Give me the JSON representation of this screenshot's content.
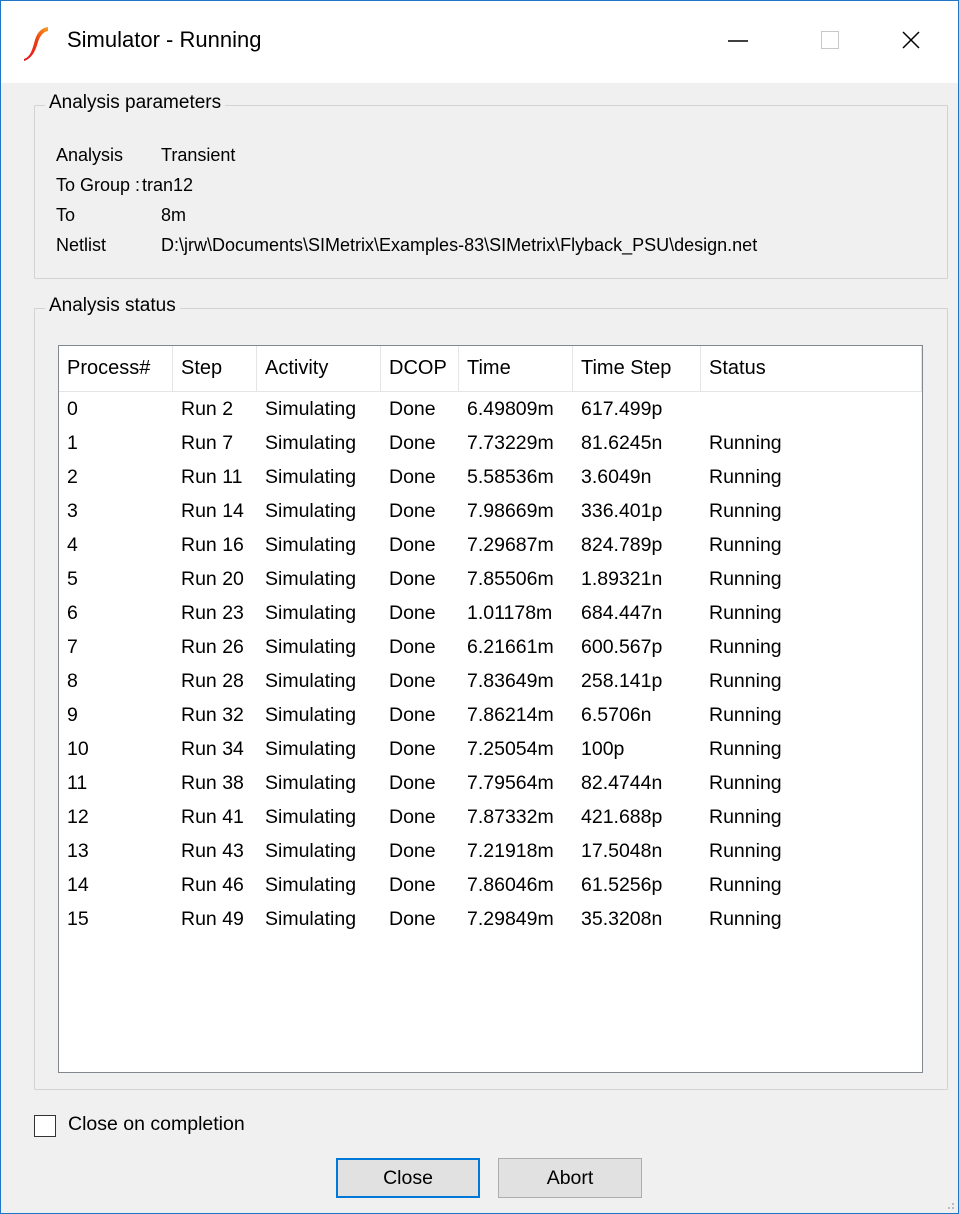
{
  "window": {
    "title": "Simulator - Running",
    "minimize_symbol": "—",
    "close_symbol": "✕"
  },
  "params": {
    "legend": "Analysis parameters",
    "rows": [
      {
        "label": "Analysis",
        "value": "Transient"
      },
      {
        "label": "To Group :",
        "value": "tran12"
      },
      {
        "label": "To",
        "value": "8m"
      },
      {
        "label": "Netlist",
        "value": "D:\\jrw\\Documents\\SIMetrix\\Examples-83\\SIMetrix\\Flyback_PSU\\design.net"
      }
    ]
  },
  "status": {
    "legend": "Analysis status",
    "columns": [
      "Process#",
      "Step",
      "Activity",
      "DCOP",
      "Time",
      "Time Step",
      "Status"
    ],
    "rows": [
      [
        "0",
        "Run 2",
        "Simulating",
        "Done",
        "6.49809m",
        "617.499p",
        ""
      ],
      [
        "1",
        "Run 7",
        "Simulating",
        "Done",
        "7.73229m",
        "81.6245n",
        "Running"
      ],
      [
        "2",
        "Run 11",
        "Simulating",
        "Done",
        "5.58536m",
        "3.6049n",
        "Running"
      ],
      [
        "3",
        "Run 14",
        "Simulating",
        "Done",
        "7.98669m",
        "336.401p",
        "Running"
      ],
      [
        "4",
        "Run 16",
        "Simulating",
        "Done",
        "7.29687m",
        "824.789p",
        "Running"
      ],
      [
        "5",
        "Run 20",
        "Simulating",
        "Done",
        "7.85506m",
        "1.89321n",
        "Running"
      ],
      [
        "6",
        "Run 23",
        "Simulating",
        "Done",
        "1.01178m",
        "684.447n",
        "Running"
      ],
      [
        "7",
        "Run 26",
        "Simulating",
        "Done",
        "6.21661m",
        "600.567p",
        "Running"
      ],
      [
        "8",
        "Run 28",
        "Simulating",
        "Done",
        "7.83649m",
        "258.141p",
        "Running"
      ],
      [
        "9",
        "Run 32",
        "Simulating",
        "Done",
        "7.86214m",
        "6.5706n",
        "Running"
      ],
      [
        "10",
        "Run 34",
        "Simulating",
        "Done",
        "7.25054m",
        "100p",
        "Running"
      ],
      [
        "11",
        "Run 38",
        "Simulating",
        "Done",
        "7.79564m",
        "82.4744n",
        "Running"
      ],
      [
        "12",
        "Run 41",
        "Simulating",
        "Done",
        "7.87332m",
        "421.688p",
        "Running"
      ],
      [
        "13",
        "Run 43",
        "Simulating",
        "Done",
        "7.21918m",
        "17.5048n",
        "Running"
      ],
      [
        "14",
        "Run 46",
        "Simulating",
        "Done",
        "7.86046m",
        "61.5256p",
        "Running"
      ],
      [
        "15",
        "Run 49",
        "Simulating",
        "Done",
        "7.29849m",
        "35.3208n",
        "Running"
      ]
    ]
  },
  "options": {
    "close_on_completion_label": "Close on completion",
    "close_on_completion_checked": false
  },
  "buttons": {
    "close_label": "Close",
    "abort_label": "Abort"
  },
  "colors": {
    "accent": "#0078d7",
    "icon_red": "#e0121a",
    "icon_orange": "#f6a31b"
  }
}
